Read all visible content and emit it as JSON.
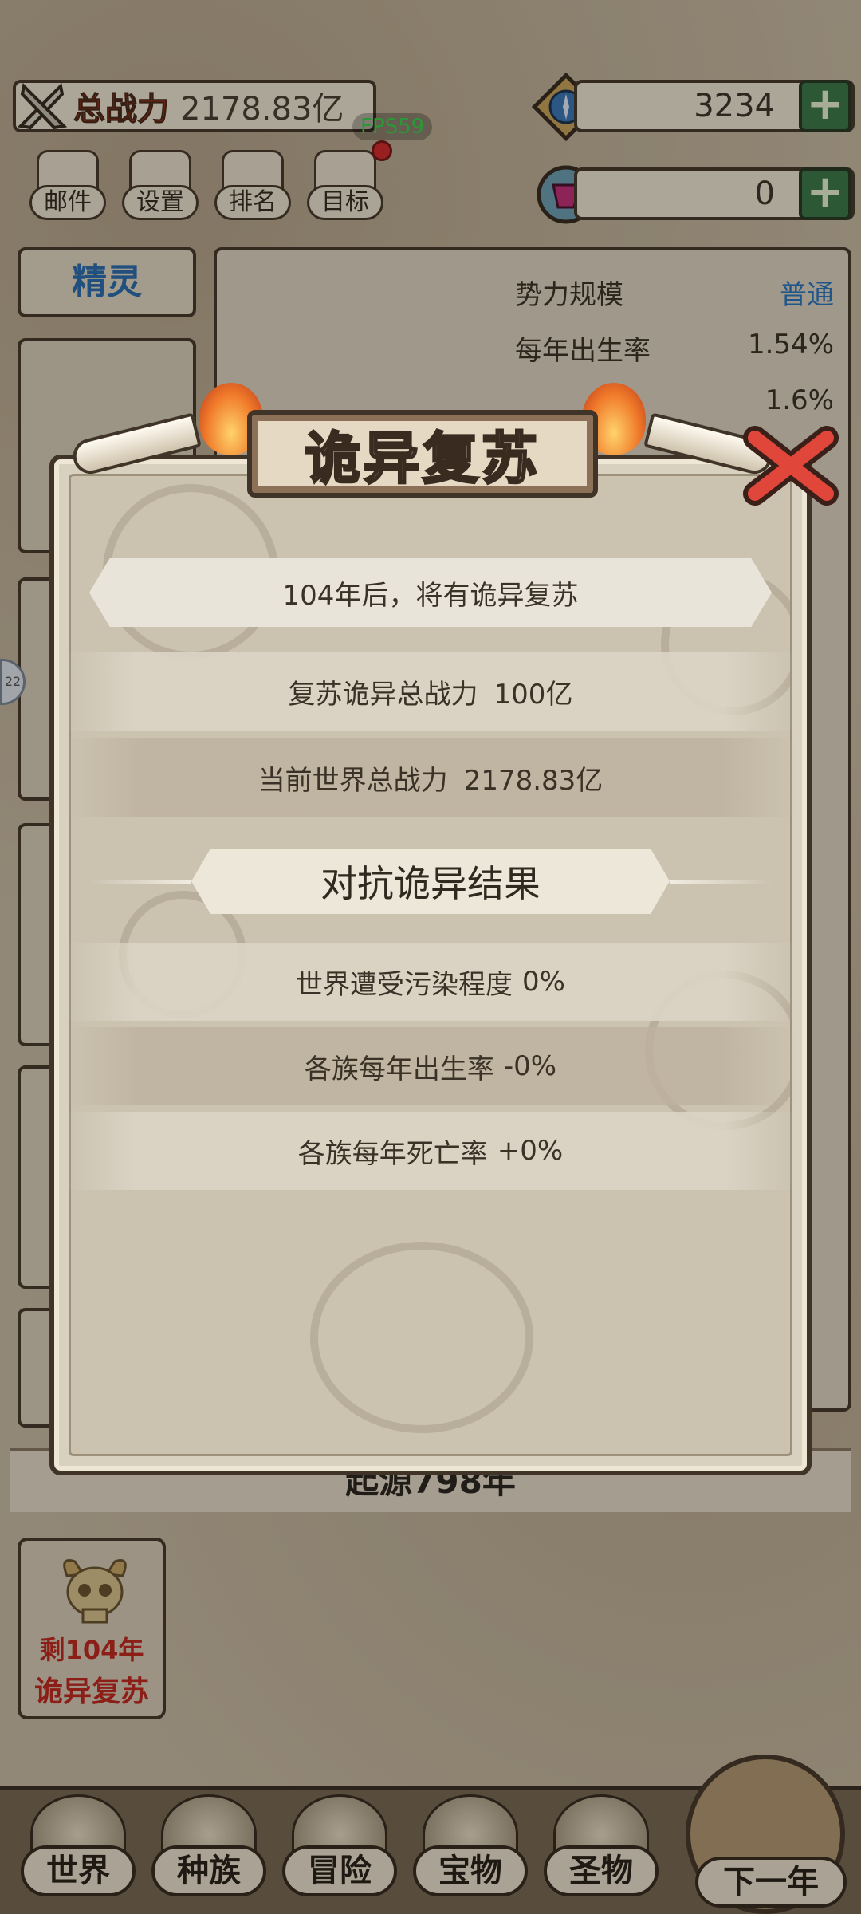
{
  "top": {
    "power_label": "总战力",
    "power_value": "2178.83亿",
    "fps": "FPS59",
    "resources": [
      {
        "value": "3234",
        "icon": "compass-gem-icon"
      },
      {
        "value": "0",
        "icon": "purple-gem-icon"
      }
    ],
    "buttons": [
      {
        "label": "邮件",
        "icon": "mail-icon"
      },
      {
        "label": "设置",
        "icon": "gear-icon"
      },
      {
        "label": "排名",
        "icon": "ranking-icon"
      },
      {
        "label": "目标",
        "icon": "target-scroll-icon"
      }
    ]
  },
  "background": {
    "side_tab": "精灵",
    "info_rows": [
      {
        "label": "势力规模",
        "value": "普通"
      },
      {
        "label": "每年出生率",
        "value": "1.54%"
      },
      {
        "label": "",
        "value": "1.6%"
      }
    ],
    "year_text": "起源798年",
    "revival_card": {
      "line1": "剩104年",
      "line2": "诡异复苏"
    },
    "edge_badge": "22"
  },
  "modal": {
    "title": "诡异复苏",
    "countdown": "104年后，将有诡异复苏",
    "stats": [
      {
        "label": "复苏诡异总战力",
        "value": "100亿"
      },
      {
        "label": "当前世界总战力",
        "value": "2178.83亿"
      }
    ],
    "section_title": "对抗诡异结果",
    "results": [
      {
        "label": "世界遭受污染程度",
        "value": "0%"
      },
      {
        "label": "各族每年出生率",
        "value": "-0%"
      },
      {
        "label": "各族每年死亡率",
        "value": "+0%"
      }
    ]
  },
  "nav": {
    "items": [
      {
        "label": "世界",
        "icon": "world-icon"
      },
      {
        "label": "种族",
        "icon": "race-icon"
      },
      {
        "label": "冒险",
        "icon": "adventure-icon"
      },
      {
        "label": "宝物",
        "icon": "treasure-chest-icon"
      },
      {
        "label": "圣物",
        "icon": "relic-icon"
      }
    ],
    "next_year": "下一年"
  }
}
